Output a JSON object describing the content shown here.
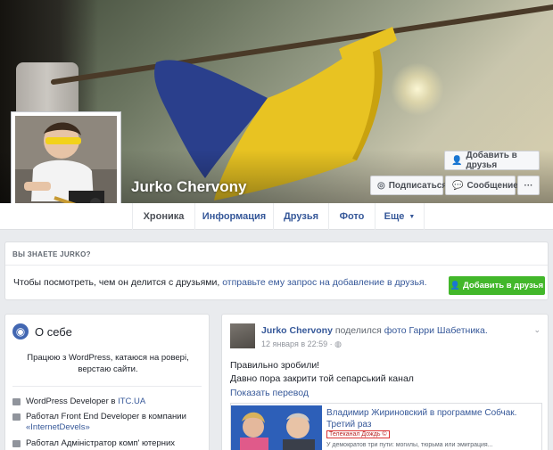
{
  "profile": {
    "name": "Jurko Chervony"
  },
  "cover_actions": {
    "add_friend": "Добавить в друзья",
    "follow": "Подписаться",
    "message": "Сообщение",
    "more": "···"
  },
  "tabs": [
    {
      "label": "Хроника"
    },
    {
      "label": "Информация"
    },
    {
      "label": "Друзья"
    },
    {
      "label": "Фото"
    },
    {
      "label": "Еще"
    }
  ],
  "know_box": {
    "header": "ВЫ ЗНАЕТЕ JURKO?",
    "text": "Чтобы посмотреть, чем он делится с друзьями,",
    "link": "отправьте ему запрос на добавление в друзья.",
    "button": "Добавить в друзья"
  },
  "about": {
    "title": "О себе",
    "bio": "Працюю з WordPress, катаюся на ровері, верстаю сайти.",
    "work": [
      {
        "text": "WordPress Developer в",
        "link": "ITC.UA"
      },
      {
        "text": "Работал Front End Developer в компании",
        "link": "«InternetDevels»"
      },
      {
        "text": "Работал Адміністратор комп' ютерних",
        "link": ""
      }
    ]
  },
  "post": {
    "author": "Jurko Chervony",
    "shared": "поделился",
    "shared_link": "фото Гарри Шабетника.",
    "date": "12 января в 22:59 ·",
    "text_line1": "Правильно зробили!",
    "text_line2": "Давно пора закрити той сепарський канал",
    "translate": "Показать перевод",
    "link_title": "Владимир Жириновский в программе Собчак. Третий раз",
    "link_badge": "Телеканал Дождь ©",
    "link_text": "У демократов три пути: могилы, тюрьма или эмиграция..."
  },
  "colors": {
    "accent": "#4267b2",
    "link": "#365899",
    "green": "#42b72a",
    "background": "#e9ebee"
  }
}
